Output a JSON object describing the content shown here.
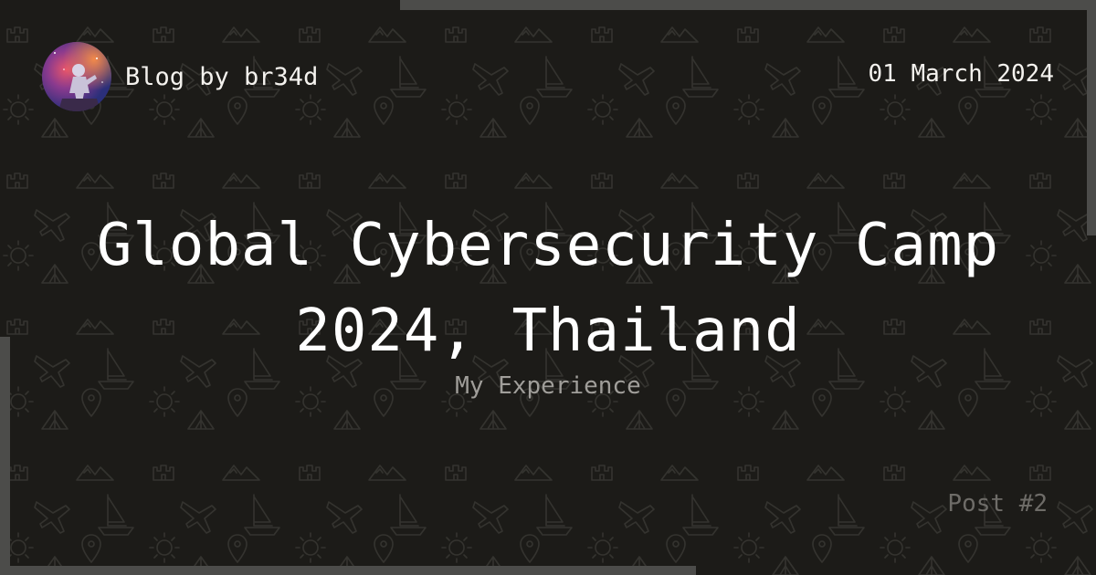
{
  "header": {
    "author_label": "Blog by br34d",
    "date": "01 March 2024"
  },
  "main": {
    "title": "Global Cybersecurity Camp 2024, Thailand",
    "subtitle": "My Experience"
  },
  "footer": {
    "post_number": "Post #2"
  },
  "avatar": {
    "icon": "astronaut-nebula-avatar-icon"
  },
  "background": {
    "pattern_icons": [
      "airplane-icon",
      "sailboat-icon",
      "sun-icon",
      "map-pin-icon",
      "mountains-icon",
      "tent-icon",
      "castle-icon"
    ]
  },
  "colors": {
    "background": "#1c1b18",
    "frame": "#4c4c4a",
    "text": "#ffffff",
    "subtitle": "#a09e9a",
    "muted": "#6e6c68"
  }
}
